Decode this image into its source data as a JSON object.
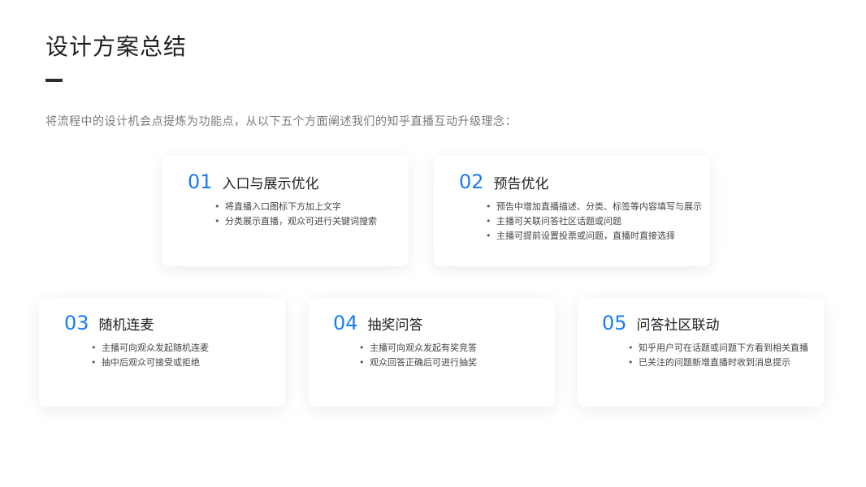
{
  "title": "设计方案总结",
  "intro": "将流程中的设计机会点提炼为功能点，从以下五个方面阐述我们的知乎直播互动升级理念：",
  "accent_color": "#1a7ef0",
  "cards": [
    {
      "number": "01",
      "title": "入口与展示优化",
      "items": [
        "将直播入口图标下方加上文字",
        "分类展示直播，观众可进行关键词搜索"
      ]
    },
    {
      "number": "02",
      "title": "预告优化",
      "items": [
        "预告中增加直播描述、分类、标签等内容填写与展示",
        "主播可关联问答社区话题或问题",
        "主播可提前设置投票或问题，直播时直接选择"
      ]
    },
    {
      "number": "03",
      "title": "随机连麦",
      "items": [
        "主播可向观众发起随机连麦",
        "抽中后观众可接受或拒绝"
      ]
    },
    {
      "number": "04",
      "title": "抽奖问答",
      "items": [
        "主播可向观众发起有奖竞答",
        "观众回答正确后可进行抽奖"
      ]
    },
    {
      "number": "05",
      "title": "问答社区联动",
      "items": [
        "知乎用户可在话题或问题下方看到相关直播",
        "已关注的问题新增直播时收到消息提示"
      ]
    }
  ]
}
